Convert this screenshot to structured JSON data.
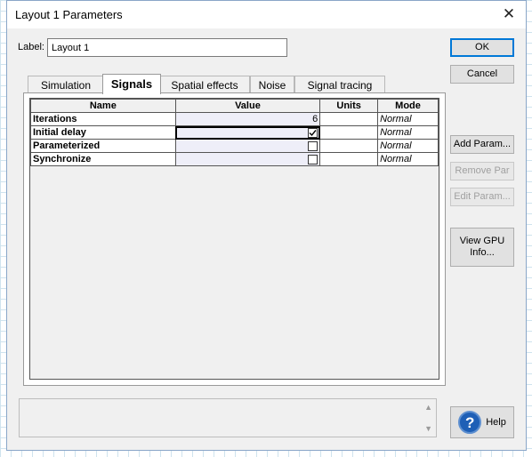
{
  "window": {
    "title": "Layout 1 Parameters",
    "close_glyph": "✕"
  },
  "label_field": {
    "label": "Label:",
    "value": "Layout 1"
  },
  "buttons": {
    "ok": "OK",
    "cancel": "Cancel",
    "add_param": "Add Param...",
    "remove_par": "Remove Par",
    "edit_param": "Edit Param...",
    "view_gpu": "View GPU Info...",
    "help": "Help"
  },
  "tabs": [
    "Simulation",
    "Signals",
    "Spatial effects",
    "Noise",
    "Signal tracing"
  ],
  "active_tab": "Signals",
  "table": {
    "headers": [
      "Name",
      "Value",
      "Units",
      "Mode"
    ],
    "rows": [
      {
        "name": "Iterations",
        "value": "6",
        "units": "",
        "mode": "Normal",
        "kind": "number"
      },
      {
        "name": "Initial delay",
        "value": "",
        "units": "",
        "mode": "Normal",
        "kind": "checkbox",
        "checked": true
      },
      {
        "name": "Parameterized",
        "value": "",
        "units": "",
        "mode": "Normal",
        "kind": "checkbox",
        "checked": false
      },
      {
        "name": "Synchronize",
        "value": "",
        "units": "",
        "mode": "Normal",
        "kind": "checkbox",
        "checked": false
      }
    ]
  },
  "scroll": {
    "up": "▲",
    "down": "▼"
  },
  "help_glyph": "?",
  "colors": {
    "accent": "#0078d7",
    "grid_bg": "#cfe3ee",
    "help_icon": "#1e5fb6"
  }
}
